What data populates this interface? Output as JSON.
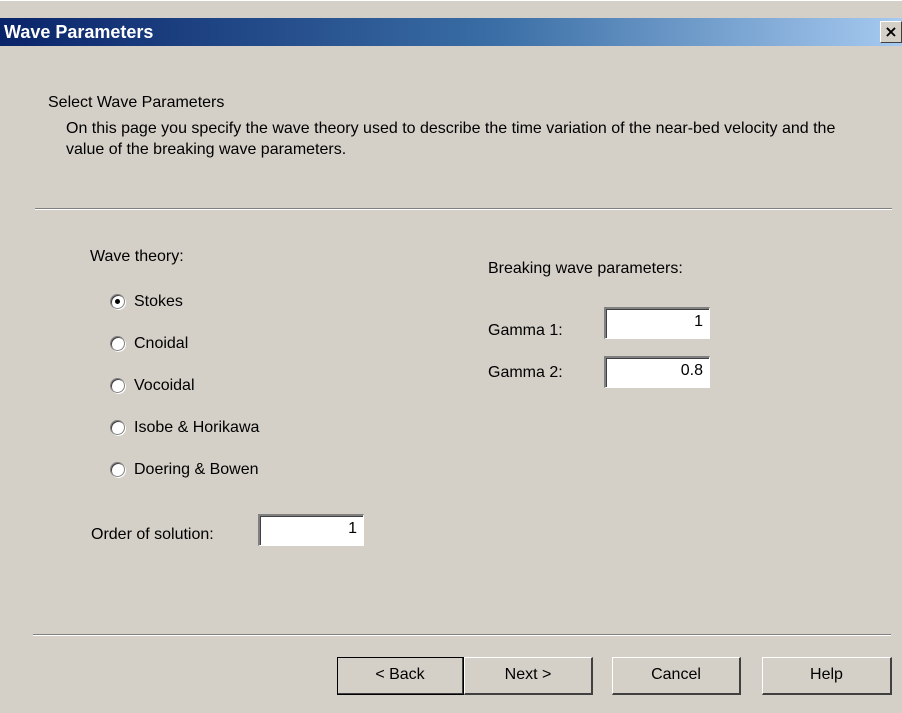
{
  "window": {
    "title": "Wave Parameters",
    "close_glyph": "×"
  },
  "header": {
    "heading": "Select Wave Parameters",
    "description": "On this page you specify the wave theory used to describe the time variation of the near-bed velocity and the value of the breaking wave parameters."
  },
  "wave_theory": {
    "label": "Wave theory:",
    "selected": "Stokes",
    "options": [
      {
        "label": "Stokes",
        "checked": true
      },
      {
        "label": "Cnoidal",
        "checked": false
      },
      {
        "label": "Vocoidal",
        "checked": false
      },
      {
        "label": "Isobe & Horikawa",
        "checked": false
      },
      {
        "label": "Doering & Bowen",
        "checked": false
      }
    ]
  },
  "order": {
    "label": "Order of solution:",
    "value": "1"
  },
  "breaking": {
    "label": "Breaking wave parameters:",
    "gamma1_label": "Gamma 1:",
    "gamma1_value": "1",
    "gamma2_label": "Gamma 2:",
    "gamma2_value": "0.8"
  },
  "buttons": {
    "back": "< Back",
    "next": "Next >",
    "cancel": "Cancel",
    "help": "Help"
  }
}
